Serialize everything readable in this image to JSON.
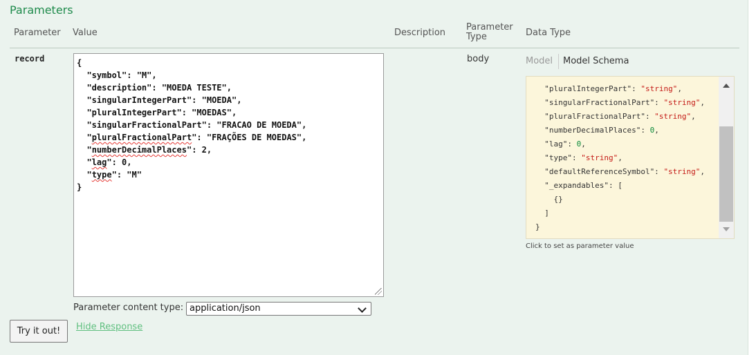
{
  "section": {
    "title": "Parameters"
  },
  "table_headers": {
    "parameter": "Parameter",
    "value": "Value",
    "description": "Description",
    "parameter_type_line1": "Parameter",
    "parameter_type_line2": "Type",
    "data_type": "Data Type"
  },
  "row": {
    "name": "record",
    "body_value": "{\n  \"symbol\": \"M\",\n  \"description\": \"MOEDA TESTE\",\n  \"singularIntegerPart\": \"MOEDA\",\n  \"pluralIntegerPart\": \"MOEDAS\",\n  \"singularFractionalPart\": \"FRACAO DE MOEDA\",\n  \"pluralFractionalPart\": \"FRAÇÕES DE MOEDAS\",\n  \"numberDecimalPlaces\": 2,\n  \"lag\": 0,\n  \"type\": \"M\"\n}",
    "parameter_type": "body"
  },
  "data_type": {
    "tabs": [
      "Model",
      "Model Schema"
    ],
    "active_tab": "Model Schema",
    "schema_lines": [
      "\"pluralIntegerPart\": \"string\",",
      "\"singularFractionalPart\": \"string\",",
      "\"pluralFractionalPart\": \"string\",",
      "\"numberDecimalPlaces\": 0,",
      "\"lag\": 0,",
      "\"type\": \"string\",",
      "\"defaultReferenceSymbol\": \"string\",",
      "\"_expandables\": [",
      "{}",
      "]",
      "}"
    ],
    "hint": "Click to set as parameter value"
  },
  "content_type": {
    "label": "Parameter content type:",
    "selected": "application/json"
  },
  "actions": {
    "try_label": "Try it out!",
    "hide_response_label": "Hide Response"
  },
  "colors": {
    "panel_bg": "#ebf3ee",
    "title_green": "#1e8a4b",
    "schema_bg": "#fcf6db",
    "string_red": "#c41a16",
    "number_green": "#0a8a3a",
    "link_green": "#5fbf7f"
  }
}
